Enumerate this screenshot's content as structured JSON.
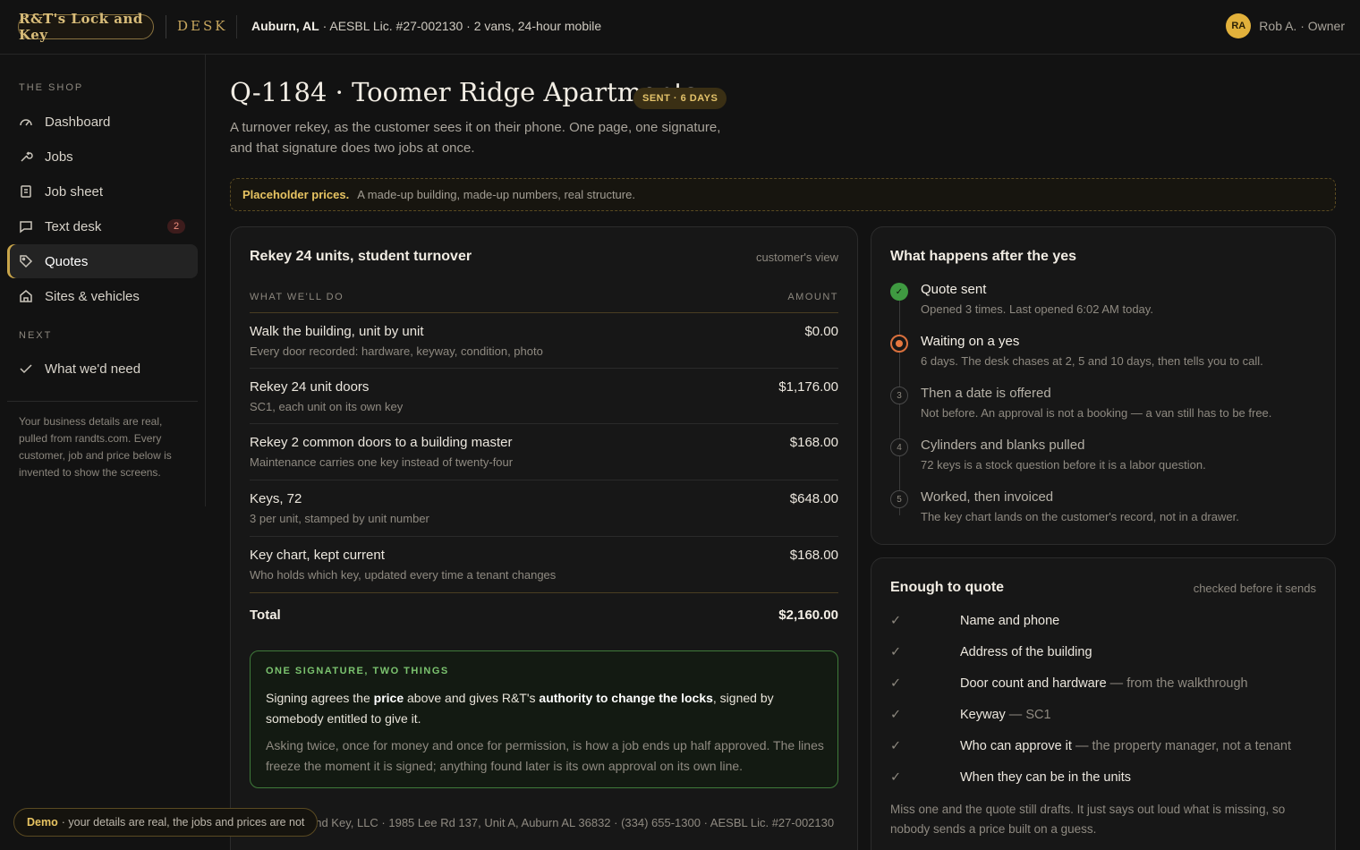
{
  "header": {
    "logo_text": "R&T's Lock and Key",
    "app_name": "DESK",
    "location": "Auburn, AL",
    "location_detail": "· AESBL Lic. #27-002130 · 2 vans, 24-hour mobile",
    "user_initials": "RA",
    "user_name": "Rob A. · Owner"
  },
  "sidebar": {
    "section_shop": "THE SHOP",
    "items": [
      {
        "label": "Dashboard",
        "icon": "gauge-icon"
      },
      {
        "label": "Jobs",
        "icon": "wrench-icon"
      },
      {
        "label": "Job sheet",
        "icon": "document-icon"
      },
      {
        "label": "Text desk",
        "icon": "chat-icon",
        "badge": "2"
      },
      {
        "label": "Quotes",
        "icon": "tag-icon",
        "active": true
      },
      {
        "label": "Sites & vehicles",
        "icon": "home-icon"
      }
    ],
    "section_next": "NEXT",
    "next_item": "What we'd need",
    "note": "Your business details are real, pulled from randts.com. Every customer, job and price below is invented to show the screens."
  },
  "quote": {
    "title": "Q-1184 · Toomer Ridge Apartments",
    "status": "SENT · 6 DAYS",
    "lede": "A turnover rekey, as the customer sees it on their phone. One page, one signature, and that signature does two jobs at once.",
    "notice_strong": "Placeholder prices.",
    "notice_text": "A made-up building, made-up numbers, real structure."
  },
  "lines_card": {
    "title": "Rekey 24 units, student turnover",
    "meta": "customer's view",
    "col_left": "WHAT WE'LL DO",
    "col_right": "AMOUNT",
    "rows": [
      {
        "title": "Walk the building, unit by unit",
        "sub": "Every door recorded: hardware, keyway, condition, photo",
        "amount": "$0.00"
      },
      {
        "title": "Rekey 24 unit doors",
        "sub": "SC1, each unit on its own key",
        "amount": "$1,176.00"
      },
      {
        "title": "Rekey 2 common doors to a building master",
        "sub": "Maintenance carries one key instead of twenty-four",
        "amount": "$168.00"
      },
      {
        "title": "Keys, 72",
        "sub": "3 per unit, stamped by unit number",
        "amount": "$648.00"
      },
      {
        "title": "Key chart, kept current",
        "sub": "Who holds which key, updated every time a tenant changes",
        "amount": "$168.00"
      }
    ],
    "total_label": "Total",
    "total_amount": "$2,160.00",
    "sig_heading": "ONE SIGNATURE, TWO THINGS",
    "sig_p1_a": "Signing agrees the ",
    "sig_p1_b": "price",
    "sig_p1_c": " above and gives R&T's ",
    "sig_p1_d": "authority to change the locks",
    "sig_p1_e": ", signed by somebody entitled to give it.",
    "sig_p2": "Asking twice, once for money and once for permission, is how a job ends up half approved. The lines freeze the moment it is signed; anything found later is its own approval on its own line.",
    "footer": "and Key, LLC · 1985 Lee Rd 137, Unit A, Auburn AL 36832 · (334) 655-1300 · AESBL Lic. #27-002130"
  },
  "after_card": {
    "title": "What happens after the yes",
    "steps": [
      {
        "state": "done",
        "marker": "✓",
        "title": "Quote sent",
        "sub": "Opened 3 times. Last opened 6:02 AM today."
      },
      {
        "state": "now",
        "marker": "",
        "title": "Waiting on a yes",
        "sub": "6 days. The desk chases at 2, 5 and 10 days, then tells you to call."
      },
      {
        "state": "todo",
        "marker": "3",
        "title": "Then a date is offered",
        "sub": "Not before. An approval is not a booking — a van still has to be free."
      },
      {
        "state": "todo",
        "marker": "4",
        "title": "Cylinders and blanks pulled",
        "sub": "72 keys is a stock question before it is a labor question."
      },
      {
        "state": "todo",
        "marker": "5",
        "title": "Worked, then invoiced",
        "sub": "The key chart lands on the customer's record, not in a drawer."
      }
    ]
  },
  "enough_card": {
    "title": "Enough to quote",
    "meta": "checked before it sends",
    "items": [
      {
        "main": "Name and phone",
        "extra": ""
      },
      {
        "main": "Address of the building",
        "extra": ""
      },
      {
        "main": "Door count and hardware",
        "extra": " — from the walkthrough"
      },
      {
        "main": "Keyway",
        "extra": " — SC1"
      },
      {
        "main": "Who can approve it",
        "extra": " — the property manager, not a tenant"
      },
      {
        "main": "When they can be in the units",
        "extra": ""
      }
    ],
    "footer": "Miss one and the quote still drafts. It just says out loud what is missing, so nobody sends a price built on a guess."
  },
  "demo": {
    "strong": "Demo",
    "text": "· your details are real, the jobs and prices are not"
  }
}
